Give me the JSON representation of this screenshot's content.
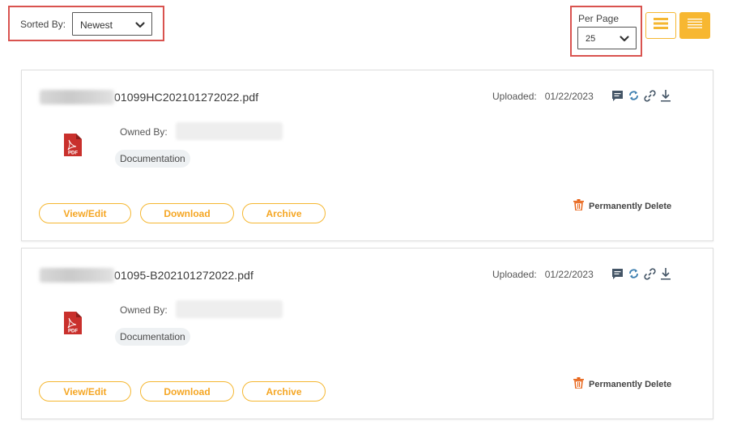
{
  "sort": {
    "label": "Sorted By:",
    "value": "Newest"
  },
  "per_page": {
    "label": "Per Page",
    "value": "25"
  },
  "view_toggle": {
    "list_icon": "list-view-icon",
    "compact_icon": "compact-list-icon"
  },
  "colors": {
    "accent": "#f5b731",
    "highlight_border": "#d9534f",
    "pdf_red": "#c9302c"
  },
  "documents": [
    {
      "filename_visible": "01099HC202101272022.pdf",
      "uploaded_label": "Uploaded:",
      "uploaded_date": "01/22/2023",
      "owned_by_label": "Owned By:",
      "tag": "Documentation",
      "actions": {
        "view": "View/Edit",
        "download": "Download",
        "archive": "Archive"
      },
      "delete_label": "Permanently Delete"
    },
    {
      "filename_visible": "01095-B202101272022.pdf",
      "uploaded_label": "Uploaded:",
      "uploaded_date": "01/22/2023",
      "owned_by_label": "Owned By:",
      "tag": "Documentation",
      "actions": {
        "view": "View/Edit",
        "download": "Download",
        "archive": "Archive"
      },
      "delete_label": "Permanently Delete"
    }
  ]
}
